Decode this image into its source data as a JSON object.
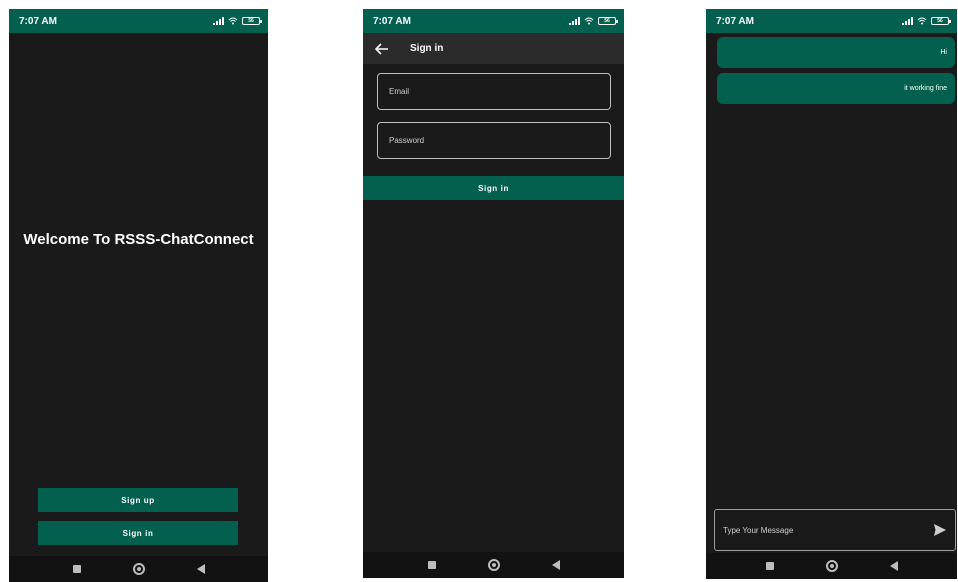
{
  "status_bar": {
    "time": "7:07 AM",
    "battery": "56"
  },
  "welcome_screen": {
    "title": "Welcome To RSSS-ChatConnect",
    "signup_label": "Sign up",
    "signin_label": "Sign in"
  },
  "signin_screen": {
    "app_bar_title": "Sign in",
    "email_placeholder": "Email",
    "password_placeholder": "Password",
    "signin_label": "Sign in"
  },
  "chat_screen": {
    "messages": [
      {
        "text": "Hi"
      },
      {
        "text": "it working fine"
      }
    ],
    "input_placeholder": "Type Your Message"
  },
  "colors": {
    "accent": "#03604f",
    "background": "#1a1a1a",
    "app_bar": "#2b2b2b",
    "nav_bar": "#121212"
  }
}
